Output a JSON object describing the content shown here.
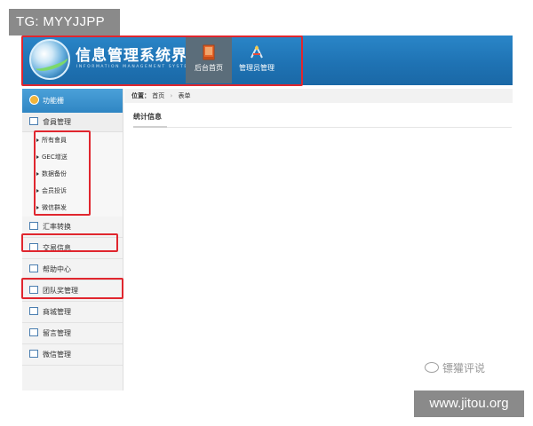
{
  "watermark_top": "TG: MYYJJPP",
  "watermark_site": "www.jitou.org",
  "watermark_wechat": "镖獾评说",
  "header": {
    "title_cn": "信息管理系统界面",
    "title_en": "INFORMATION MANAGEMENT SYSTEM GUI",
    "nav": [
      {
        "label": "后台首页",
        "icon": "book-icon"
      },
      {
        "label": "管理员管理",
        "icon": "tools-icon"
      }
    ]
  },
  "sidebar": {
    "header": "功能栅",
    "group": {
      "title": "會員管理",
      "items": [
        "所有會員",
        "GEC增送",
        "数据备份",
        "会员投诉",
        "微信群发"
      ]
    },
    "items": [
      {
        "label": "汇率转换",
        "icon": "chat-icon"
      },
      {
        "label": "交易信息",
        "icon": "document-icon"
      },
      {
        "label": "帮助中心",
        "icon": "edit-icon"
      },
      {
        "label": "团队奖管理",
        "icon": "calendar-icon"
      },
      {
        "label": "商城管理",
        "icon": "document-icon"
      },
      {
        "label": "留言管理",
        "icon": "edit-icon"
      },
      {
        "label": "微信管理",
        "icon": "chat-icon"
      }
    ]
  },
  "breadcrumb": {
    "label": "位置：",
    "items": [
      "首页",
      "表单"
    ]
  },
  "content": {
    "title": "统计信息"
  },
  "colors": {
    "header_blue": "#1f73b4",
    "highlight_red": "#e0262e"
  }
}
